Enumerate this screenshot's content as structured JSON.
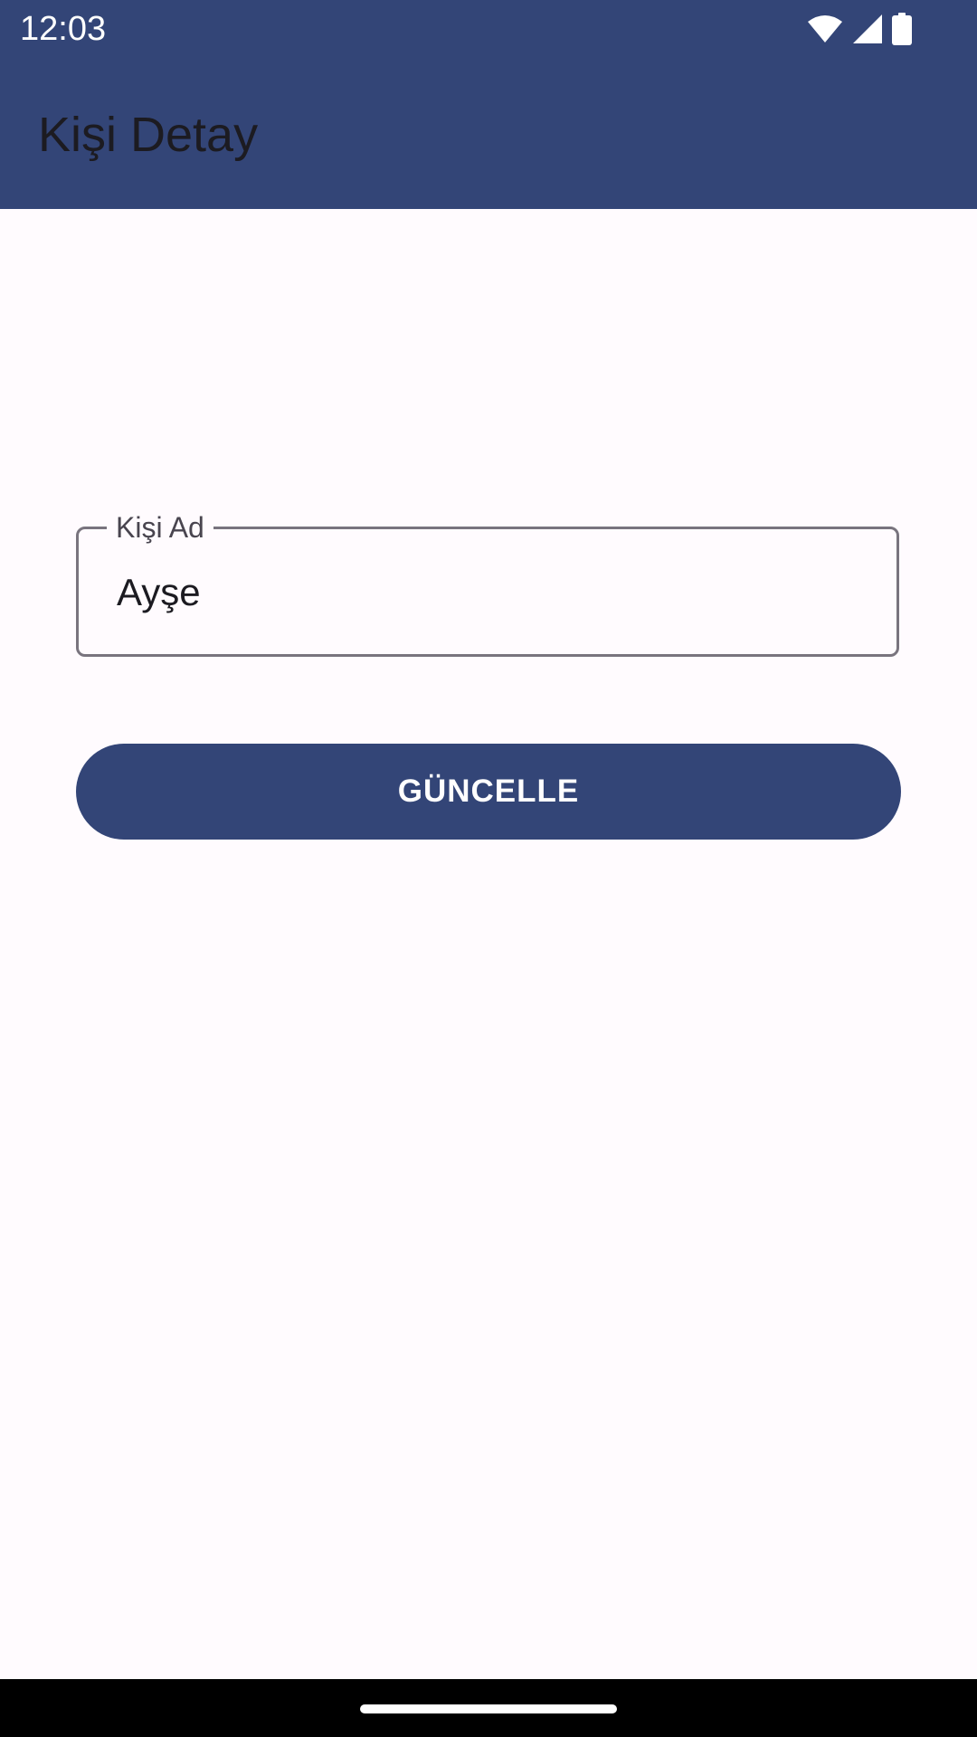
{
  "status_bar": {
    "time": "12:03",
    "icons": [
      "wifi-icon",
      "cellular-signal-icon",
      "battery-icon"
    ]
  },
  "app_bar": {
    "title": "Kişi Detay"
  },
  "form": {
    "name_field": {
      "label": "Kişi Ad",
      "value": "Ayşe"
    },
    "update_button_label": "GÜNCELLE"
  },
  "colors": {
    "primary": "#334577",
    "background": "#fffbfe",
    "outline": "#79747e",
    "on_surface": "#1c1b21",
    "on_primary": "#ffffff"
  }
}
